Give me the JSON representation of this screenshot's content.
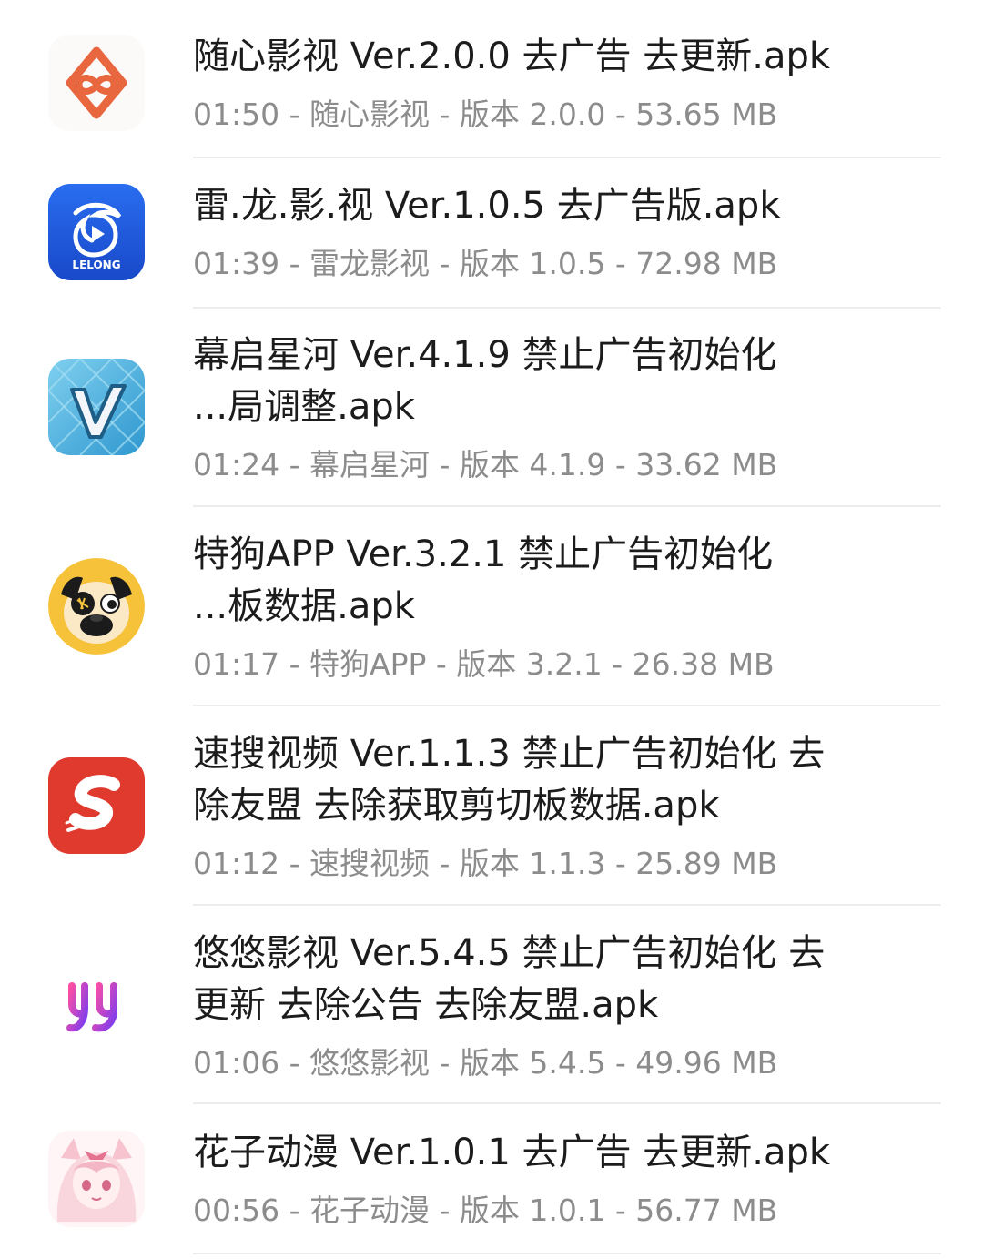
{
  "downloads": [
    {
      "icon": "suixin-app-icon",
      "title_lines": [
        "随心影视 Ver.2.0.0 去广告 去更新.apk"
      ],
      "time": "01:50",
      "app": "随心影视",
      "version_label": "版本",
      "version": "2.0.0",
      "size": "53.65 MB"
    },
    {
      "icon": "leilong-app-icon",
      "icon_text": "LELONG",
      "title_lines": [
        "雷.龙.影.视 Ver.1.0.5 去广告版.apk"
      ],
      "time": "01:39",
      "app": "雷龙影视",
      "version_label": "版本",
      "version": "1.0.5",
      "size": "72.98 MB"
    },
    {
      "icon": "muqi-app-icon",
      "title_lines": [
        "幕启星河 Ver.4.1.9 禁止广告初始化",
        "...局调整.apk"
      ],
      "time": "01:24",
      "app": "幕启星河",
      "version_label": "版本",
      "version": "4.1.9",
      "size": "33.62 MB"
    },
    {
      "icon": "tegou-app-icon",
      "title_lines": [
        "特狗APP Ver.3.2.1 禁止广告初始化",
        "...板数据.apk"
      ],
      "time": "01:17",
      "app": "特狗APP",
      "version_label": "版本",
      "version": "3.2.1",
      "size": "26.38 MB"
    },
    {
      "icon": "susou-app-icon",
      "title_lines": [
        "速搜视频 Ver.1.1.3 禁止广告初始化 去",
        "除友盟 去除获取剪切板数据.apk"
      ],
      "time": "01:12",
      "app": "速搜视频",
      "version_label": "版本",
      "version": "1.1.3",
      "size": "25.89 MB"
    },
    {
      "icon": "youyou-app-icon",
      "title_lines": [
        "悠悠影视 Ver.5.4.5 禁止广告初始化 去",
        "更新 去除公告 去除友盟.apk"
      ],
      "time": "01:06",
      "app": "悠悠影视",
      "version_label": "版本",
      "version": "5.4.5",
      "size": "49.96 MB"
    },
    {
      "icon": "huazi-app-icon",
      "title_lines": [
        "花子动漫 Ver.1.0.1 去广告 去更新.apk"
      ],
      "time": "00:56",
      "app": "花子动漫",
      "version_label": "版本",
      "version": "1.0.1",
      "size": "56.77 MB"
    }
  ],
  "separator": " - ",
  "colors": {
    "title": "#1c1c1c",
    "meta": "#8c8c8c",
    "divider": "#ececec"
  }
}
